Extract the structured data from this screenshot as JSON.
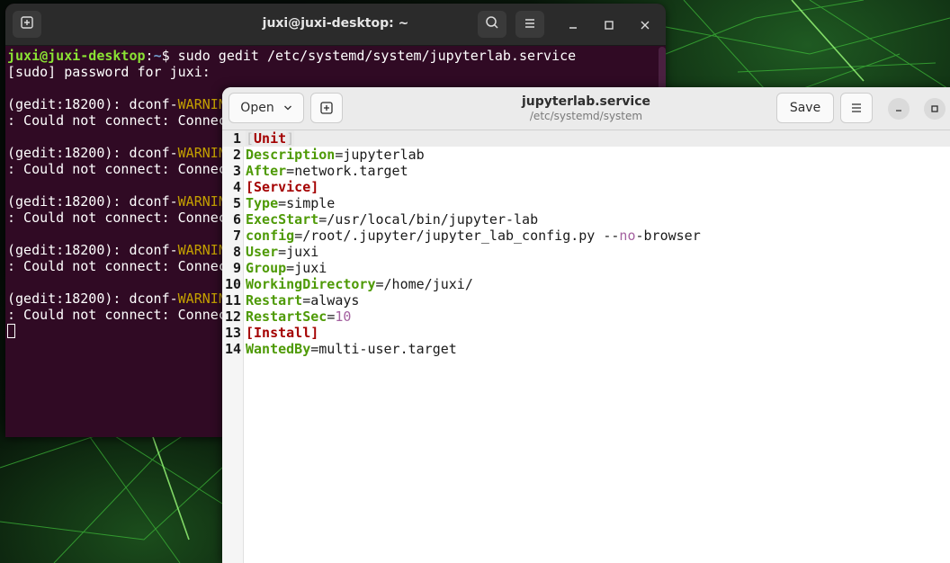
{
  "terminal": {
    "title": "juxi@juxi-desktop: ~",
    "prompt_user": "juxi@juxi-desktop",
    "prompt_sep": ":",
    "prompt_path": "~",
    "prompt_symbol": "$ ",
    "command": "sudo gedit /etc/systemd/system/jupyterlab.service",
    "sudo_prompt": "[sudo] password for juxi:",
    "warn_prefix": "(gedit:18200): dconf-",
    "warn_word": "WARNIN",
    "warn_detail": ": Could not connect: Connec"
  },
  "gedit": {
    "open_label": "Open",
    "save_label": "Save",
    "file_name": "jupyterlab.service",
    "file_path": "/etc/systemd/system",
    "lines": [
      {
        "n": "1"
      },
      {
        "n": "2"
      },
      {
        "n": "3"
      },
      {
        "n": "4"
      },
      {
        "n": "5"
      },
      {
        "n": "6"
      },
      {
        "n": "7"
      },
      {
        "n": "8"
      },
      {
        "n": "9"
      },
      {
        "n": "10"
      },
      {
        "n": "11"
      },
      {
        "n": "12"
      },
      {
        "n": "13"
      },
      {
        "n": "14"
      }
    ],
    "code": {
      "l1": {
        "open": "[",
        "section": "Unit",
        "close": "]"
      },
      "l2": {
        "key": "Description",
        "eq": "=",
        "val": "jupyterlab"
      },
      "l3": {
        "key": "After",
        "eq": "=",
        "val": "network.target"
      },
      "l4": {
        "section": "[Service]"
      },
      "l5": {
        "key": "Type",
        "eq": "=",
        "val": "simple"
      },
      "l6": {
        "key": "ExecStart",
        "eq": "=",
        "val": "/usr/local/bin/jupyter-lab"
      },
      "l7": {
        "key": "config",
        "eq": "=",
        "val_a": "/root/.jupyter/jupyter_lab_config.py --",
        "val_no": "no",
        "val_b": "-browser"
      },
      "l8": {
        "key": "User",
        "eq": "=",
        "val": "juxi"
      },
      "l9": {
        "key": "Group",
        "eq": "=",
        "val": "juxi"
      },
      "l10": {
        "key": "WorkingDirectory",
        "eq": "=",
        "val": "/home/juxi/"
      },
      "l11": {
        "key": "Restart",
        "eq": "=",
        "val": "always"
      },
      "l12": {
        "key": "RestartSec",
        "eq": "=",
        "num": "10"
      },
      "l13": {
        "section": "[Install]"
      },
      "l14": {
        "key": "WantedBy",
        "eq": "=",
        "val": "multi-user.target"
      }
    }
  },
  "icons": {
    "new_tab": "new-tab-icon",
    "search": "search-icon",
    "menu": "hamburger-menu-icon",
    "minimize": "minimize-icon",
    "maximize": "maximize-icon",
    "close": "close-icon",
    "chevron": "chevron-down-icon",
    "new_document": "new-document-icon"
  },
  "colors": {
    "terminal_bg": "#300a24",
    "prompt_user": "#8ae234",
    "prompt_path": "#729fcf",
    "warning": "#c4a000",
    "key": "#4e9a06",
    "section": "#a40000",
    "number": "#a461a0"
  }
}
